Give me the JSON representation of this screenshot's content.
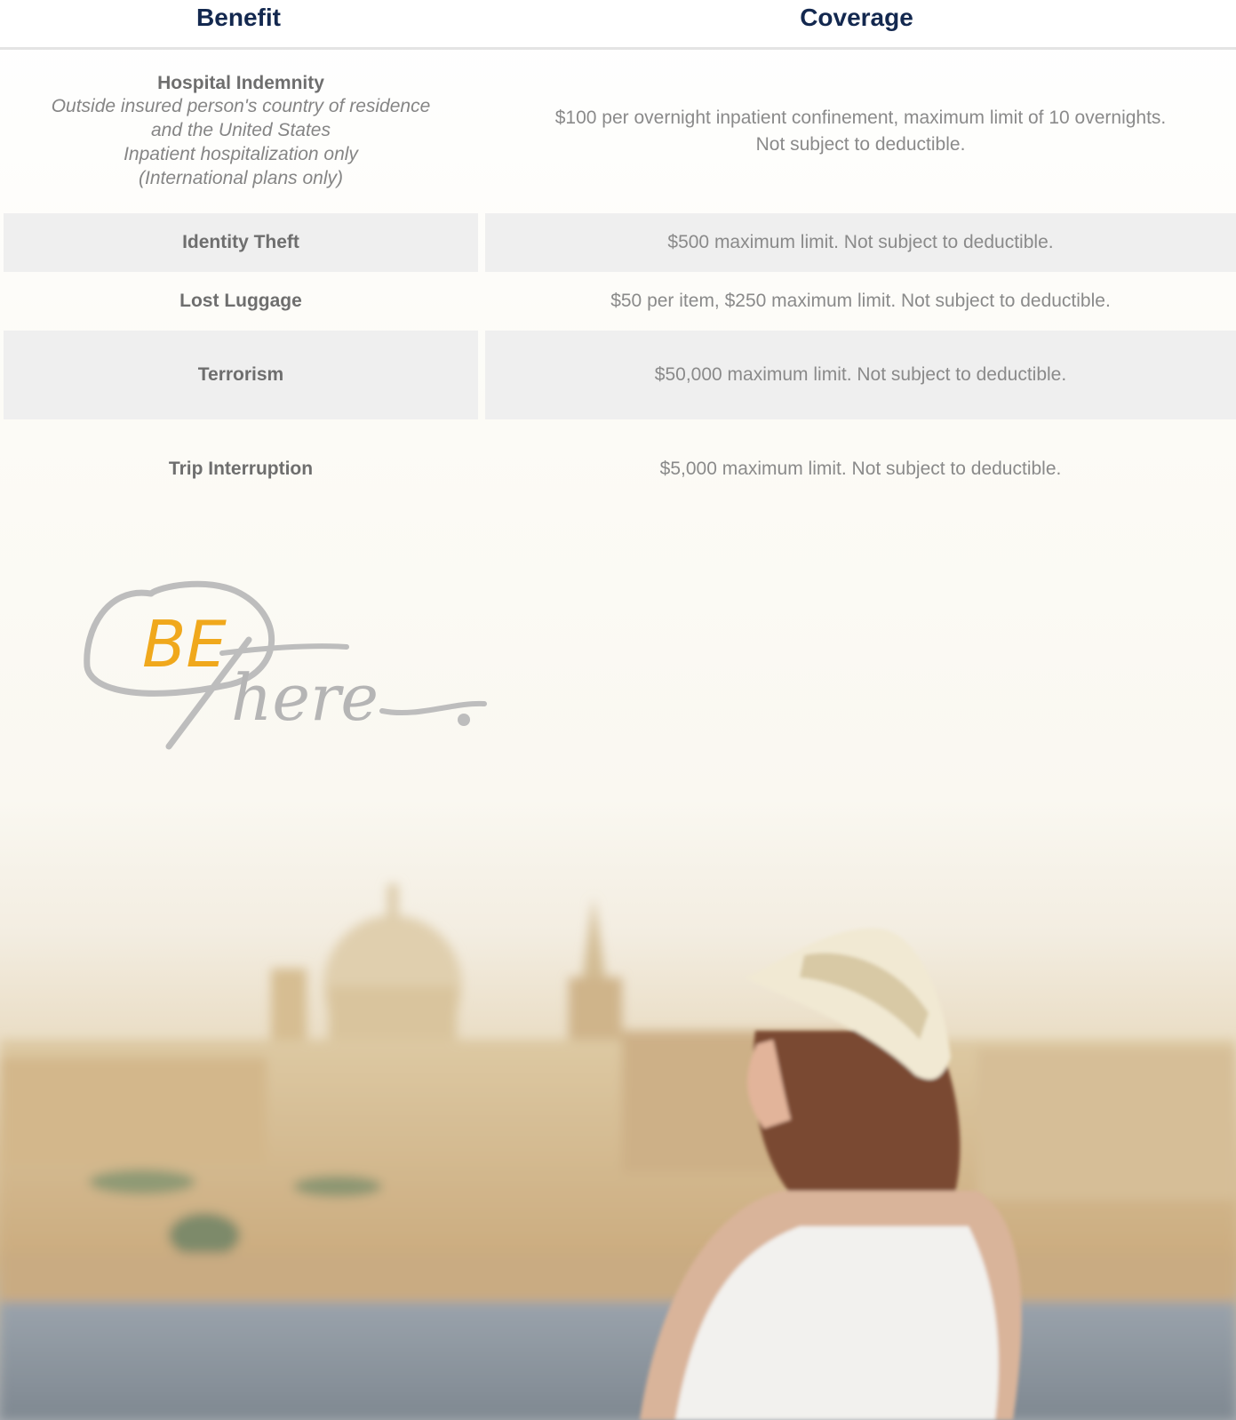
{
  "table": {
    "headers": {
      "benefit": "Benefit",
      "coverage": "Coverage"
    },
    "rows": [
      {
        "benefit": "Hospital Indemnity",
        "benefit_notes": [
          "Outside insured person's country of residence",
          "and the United States",
          "Inpatient hospitalization only",
          "(International plans only)"
        ],
        "coverage": [
          "$100 per overnight inpatient confinement, maximum limit of 10 overnights.",
          "Not subject to deductible."
        ]
      },
      {
        "benefit": "Identity Theft",
        "coverage": [
          "$500 maximum limit. Not subject to deductible."
        ]
      },
      {
        "benefit": "Lost Luggage",
        "coverage": [
          "$50 per item, $250 maximum limit. Not subject to deductible."
        ]
      },
      {
        "benefit": "Terrorism",
        "coverage": [
          "$50,000 maximum limit. Not subject to deductible."
        ]
      },
      {
        "benefit": "Trip Interruption",
        "coverage": [
          "$5,000 maximum limit. Not subject to deductible."
        ]
      }
    ]
  },
  "logo": {
    "part1": "BE",
    "part2": "There."
  },
  "colors": {
    "header_text": "#13284f",
    "logo_accent": "#f0a81c",
    "logo_script": "#b5b5b5",
    "row_shade": "#efefef"
  }
}
